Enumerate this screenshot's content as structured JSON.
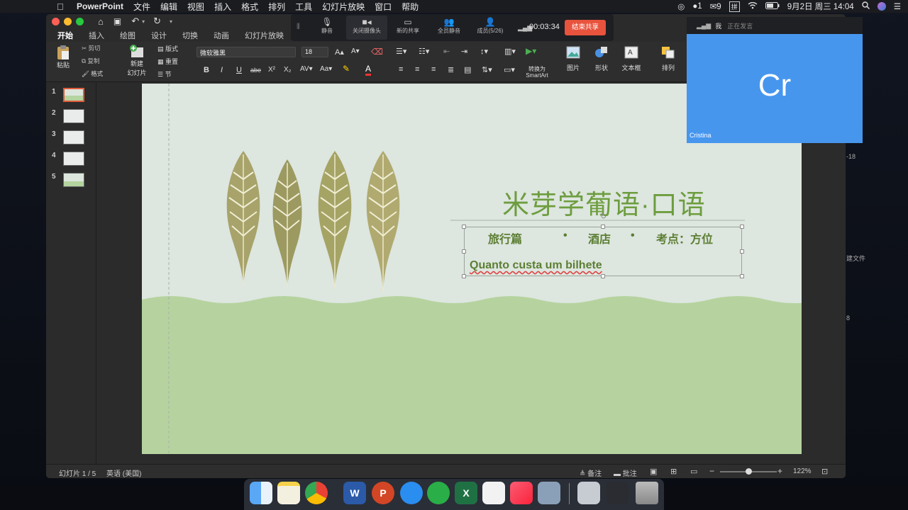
{
  "menubar": {
    "app": "PowerPoint",
    "items": [
      "文件",
      "编辑",
      "视图",
      "插入",
      "格式",
      "排列",
      "工具",
      "幻灯片放映",
      "窗口",
      "帮助"
    ],
    "wechat_badge": "9",
    "input_method": "拼",
    "datetime": "9月2日 周三 14:04"
  },
  "ribbon_tabs": [
    "开始",
    "插入",
    "绘图",
    "设计",
    "切换",
    "动画",
    "幻灯片放映"
  ],
  "ribbon": {
    "paste": "粘贴",
    "cut": "剪切",
    "copy": "复制",
    "format": "格式",
    "new_slide": "新建",
    "new_slide2": "幻灯片",
    "layout": "版式",
    "reset": "重置",
    "section": "节",
    "font_name": "微软雅黑",
    "font_size": "18",
    "bold": "B",
    "italic": "I",
    "underline": "U",
    "strike": "abe",
    "superscript": "X²",
    "subscript": "X₂",
    "convert_smartart": "转换为",
    "convert_smartart2": "SmartArt",
    "picture": "图片",
    "shape": "形状",
    "textbox": "文本框",
    "arrange": "排列"
  },
  "meeting": {
    "mute": "静音",
    "stop_camera": "关闭摄像头",
    "new_share": "新的共享",
    "mute_all": "全员静音",
    "members": "成员(5/26)",
    "timer": "00:03:34",
    "end_share": "结束共享"
  },
  "video": {
    "speaker_label": "我",
    "speaking_status": "正在发言",
    "initials": "Cr",
    "name": "Cristina"
  },
  "slides": [
    "1",
    "2",
    "3",
    "4",
    "5"
  ],
  "slide": {
    "title": "米芽学葡语·口语",
    "sub1": "旅行篇",
    "sub2": "酒店",
    "sub3": "考点：方位",
    "body": "Quanto custa um bilhete"
  },
  "status": {
    "slide_count": "幻灯片 1 / 5",
    "language": "英语 (美国)",
    "notes": "备注",
    "comments": "批注",
    "zoom": "122%"
  },
  "side_texts": {
    "a": "-18",
    "b": "建文件",
    "c": "8"
  }
}
